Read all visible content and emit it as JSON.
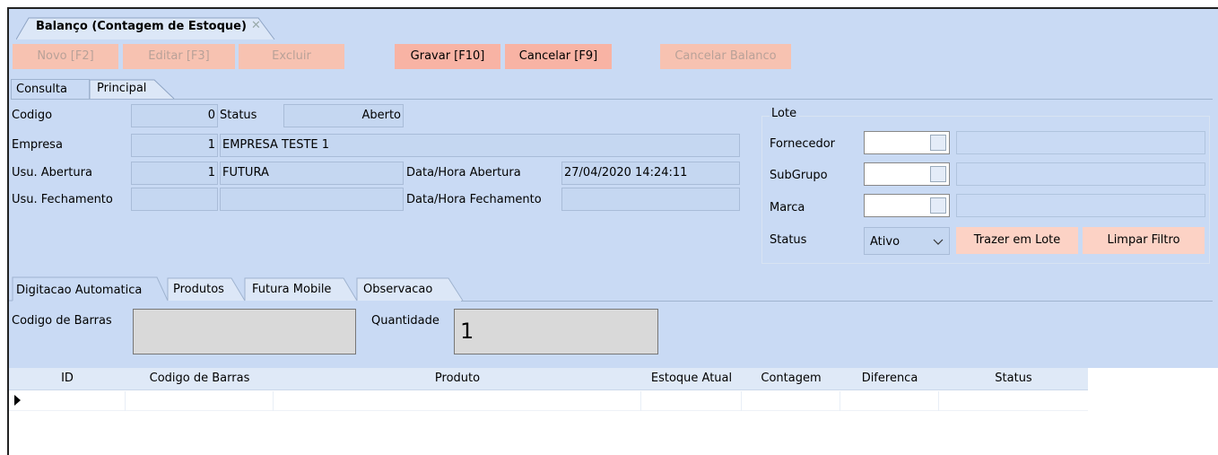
{
  "window": {
    "title": "Balanço (Contagem de Estoque)",
    "close": "✕"
  },
  "toolbar": {
    "novo": "Novo [F2]",
    "editar": "Editar [F3]",
    "excluir": "Excluir",
    "gravar": "Gravar [F10]",
    "cancelar": "Cancelar [F9]",
    "cancelar_balanco": "Cancelar Balanco"
  },
  "tabs": {
    "consulta": "Consulta",
    "principal": "Principal"
  },
  "form": {
    "codigo_label": "Codigo",
    "codigo_value": "0",
    "status_label": "Status",
    "status_value": "Aberto",
    "empresa_label": "Empresa",
    "empresa_id": "1",
    "empresa_name": "EMPRESA TESTE 1",
    "usu_abertura_label": "Usu. Abertura",
    "usu_abertura_id": "1",
    "usu_abertura_name": "FUTURA",
    "data_abertura_label": "Data/Hora Abertura",
    "data_abertura_value": "27/04/2020 14:24:11",
    "usu_fechamento_label": "Usu. Fechamento",
    "usu_fechamento_id": "",
    "usu_fechamento_name": "",
    "data_fechamento_label": "Data/Hora Fechamento",
    "data_fechamento_value": ""
  },
  "lote": {
    "title": "Lote",
    "fornecedor": "Fornecedor",
    "subgrupo": "SubGrupo",
    "marca": "Marca",
    "status": "Status",
    "status_value": "Ativo",
    "trazer": "Trazer em Lote",
    "limpar": "Limpar Filtro"
  },
  "inner_tabs": {
    "digitacao": "Digitacao Automatica",
    "produtos": "Produtos",
    "mobile": "Futura Mobile",
    "observacao": "Observacao"
  },
  "entry": {
    "barras_label": "Codigo de Barras",
    "barras_value": "",
    "quantidade_label": "Quantidade",
    "quantidade_value": "1"
  },
  "grid": {
    "columns": [
      "ID",
      "Codigo de Barras",
      "Produto",
      "Estoque Atual",
      "Contagem",
      "Diferenca",
      "Status"
    ]
  }
}
